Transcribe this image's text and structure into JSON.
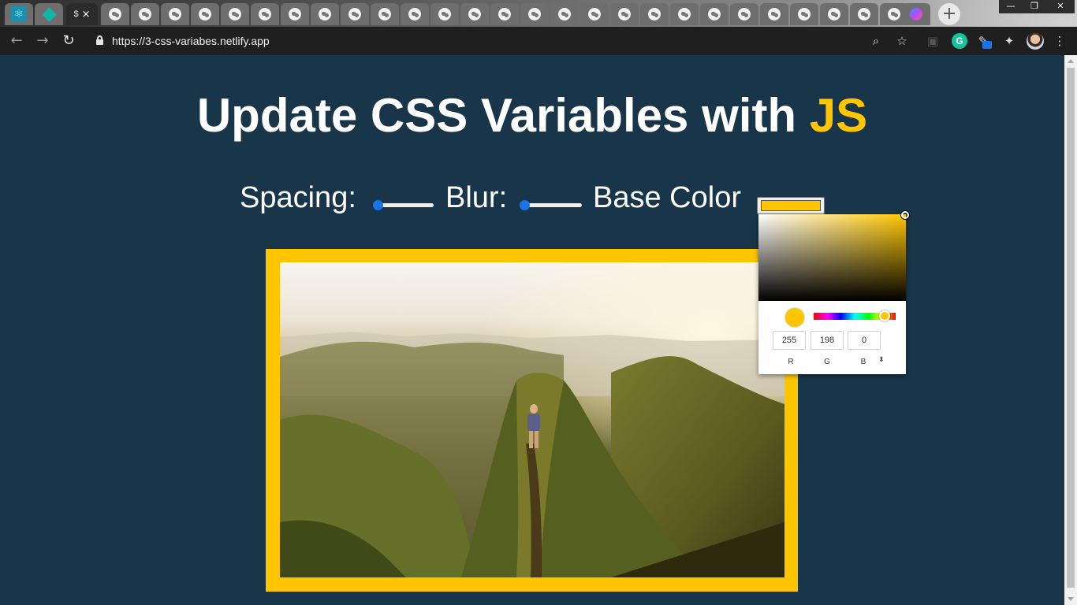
{
  "browser": {
    "tab_count_globe": 27,
    "active_tab_label": "$",
    "tab_close_glyph": "×",
    "new_tab_glyph": "+",
    "window_controls": [
      "—",
      "❐",
      "✕"
    ],
    "url": "https://3-css-variabes.netlify.app",
    "icons": [
      "back-arrow-icon",
      "forward-arrow-icon",
      "reload-icon",
      "lock-icon",
      "zoom-icon",
      "star-icon",
      "extension-icon",
      "grammarly-icon",
      "pen-extension-icon",
      "puzzle-icon",
      "profile-avatar",
      "kebab-menu-icon"
    ]
  },
  "page": {
    "title_main": "Update CSS Variables with ",
    "title_highlight": "JS",
    "spacing_label": "Spacing:",
    "blur_label": "Blur:",
    "base_color_label": "Base Color",
    "spacing_value_fraction": 0.0,
    "blur_value_fraction": 0.0,
    "base_color": "#ffc600",
    "background_color": "#193549"
  },
  "color_picker": {
    "r": "255",
    "g": "198",
    "b": "0",
    "r_label": "R",
    "g_label": "G",
    "b_label": "B",
    "mode_toggle_glyph": "⬍"
  }
}
